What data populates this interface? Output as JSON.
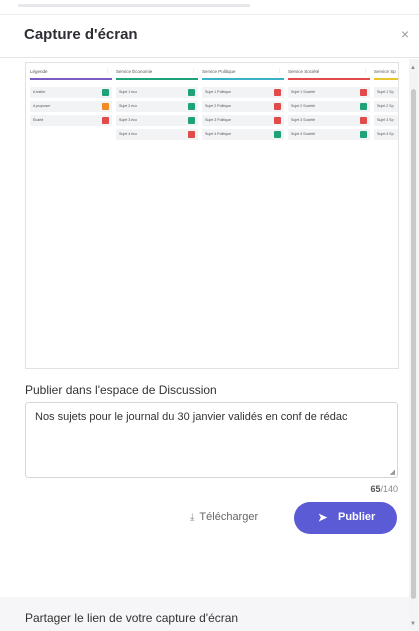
{
  "modal": {
    "title": "Capture d'écran",
    "close_glyph": "×"
  },
  "board": {
    "columns": [
      {
        "title": "Légende",
        "color": "#7c5cbf",
        "cards": [
          {
            "label": "A traiter",
            "count": "",
            "badge_color": "#1fa27a"
          },
          {
            "label": "A proposer",
            "count": "",
            "badge_color": "#f08a24"
          },
          {
            "label": "Écarté",
            "count": "",
            "badge_color": "#e24b4b"
          }
        ]
      },
      {
        "title": "Service Économie",
        "color": "#1fa27a",
        "cards": [
          {
            "label": "Sujet 1 éco",
            "count": "",
            "badge_color": "#1fa27a"
          },
          {
            "label": "Sujet 2 éco",
            "count": "",
            "badge_color": "#1fa27a"
          },
          {
            "label": "Sujet 3 éco",
            "count": "",
            "badge_color": "#1fa27a"
          },
          {
            "label": "Sujet 4 éco",
            "count": "",
            "badge_color": "#e24b4b"
          }
        ]
      },
      {
        "title": "Service Politique",
        "color": "#3bb0c9",
        "cards": [
          {
            "label": "Sujet 1 Politique",
            "count": "",
            "badge_color": "#e24b4b"
          },
          {
            "label": "Sujet 2 Politique",
            "count": "",
            "badge_color": "#e24b4b"
          },
          {
            "label": "Sujet 3 Politique",
            "count": "",
            "badge_color": "#e24b4b"
          },
          {
            "label": "Sujet 4 Politique",
            "count": "",
            "badge_color": "#1fa27a"
          }
        ]
      },
      {
        "title": "Service Société",
        "color": "#e24b4b",
        "cards": [
          {
            "label": "Sujet 1 Société",
            "count": "",
            "badge_color": "#e24b4b"
          },
          {
            "label": "Sujet 2 Société",
            "count": "",
            "badge_color": "#1fa27a"
          },
          {
            "label": "Sujet 3 Société",
            "count": "",
            "badge_color": "#e24b4b"
          },
          {
            "label": "Sujet 4 Société",
            "count": "",
            "badge_color": "#1fa27a"
          }
        ]
      },
      {
        "title": "Service Sp",
        "color": "#e8c430",
        "cards": [
          {
            "label": "Sujet 1 Sp",
            "count": "",
            "badge_color": ""
          },
          {
            "label": "Sujet 2 Sp",
            "count": "",
            "badge_color": ""
          },
          {
            "label": "Sujet 3 Sp",
            "count": "",
            "badge_color": ""
          },
          {
            "label": "Sujet 4 Sp",
            "count": "",
            "badge_color": ""
          }
        ]
      }
    ]
  },
  "publish_section": {
    "label": "Publier dans l'espace de Discussion",
    "message_value": "Nos sujets pour le journal du 30 janvier validés en conf de rédac",
    "char_count": "65",
    "char_max": "/140",
    "download_label": "Télécharger",
    "publish_label": "Publier"
  },
  "share_section": {
    "label": "Partager le lien de votre capture d'écran"
  }
}
